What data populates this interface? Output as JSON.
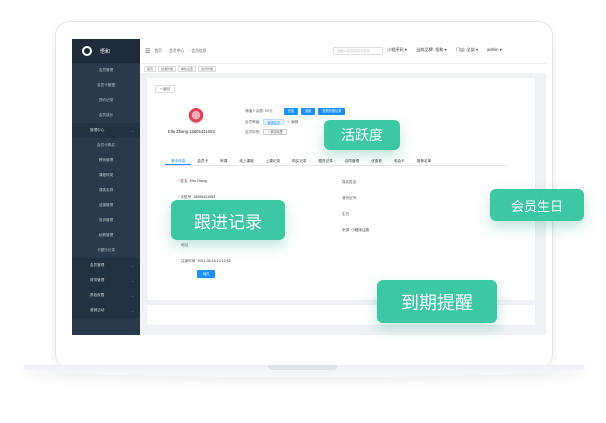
{
  "colors": {
    "accent": "#1890ff",
    "badge": "#3cc8a2",
    "sidebar": "#2b3a4a"
  },
  "sidebar": {
    "brand": "悟和",
    "items": [
      {
        "label": "会员管理",
        "type": "sub"
      },
      {
        "label": "会员卡管理",
        "type": "sub"
      },
      {
        "label": "预约记录",
        "type": "sub"
      },
      {
        "label": "会员成长",
        "type": "sub"
      },
      {
        "label": "管理中心",
        "type": "group"
      },
      {
        "label": "会员卡购买",
        "type": "sub"
      },
      {
        "label": "教师管理",
        "type": "sub"
      },
      {
        "label": "课程种类",
        "type": "sub"
      },
      {
        "label": "课类名称",
        "type": "sub"
      },
      {
        "label": "活课管理",
        "type": "sub"
      },
      {
        "label": "培训管理",
        "type": "sub"
      },
      {
        "label": "私教管理",
        "type": "sub"
      },
      {
        "label": "卡额抄记录",
        "type": "sub"
      },
      {
        "label": "会员管理",
        "type": "group"
      },
      {
        "label": "财务管理",
        "type": "group"
      },
      {
        "label": "角色权限",
        "type": "group"
      },
      {
        "label": "营销活动",
        "type": "group"
      }
    ]
  },
  "topbar": {
    "breadcrumb": [
      "首页",
      "会员中心",
      "会员信息"
    ],
    "search_placeholder": "请输入会员姓名/手机号",
    "right": [
      "小程序码 ▾",
      "当前品牌: 悟和 ▾",
      "门店: 全部 ▾",
      "admin ▾"
    ]
  },
  "tags": [
    "首页",
    "投课管理",
    "单处设置",
    "会员管理"
  ],
  "card": {
    "back_label": "< 返回",
    "member_name": "Ella Zhang 15605431553",
    "balance_label": "储值卡余额: ¥0元",
    "btn_recharge": "充值",
    "btn_refund": "退款",
    "btn_record": "查看充值记录",
    "level_label": "会员等级:",
    "level_value": "普通会员",
    "edit_label": "✎ 编辑",
    "tags_label": "会员标签:",
    "add_tag": "+ 添加标签",
    "tabs": [
      "基本信息",
      "会员卡",
      "练课",
      "线上课程",
      "上课记录",
      "购买记录",
      "跟进记录",
      "合同管理",
      "优惠券",
      "电会卡",
      "推荐名单"
    ],
    "fields_left": [
      {
        "label": "姓名",
        "value": "Ella Zhang",
        "required": true
      },
      {
        "label": "手机号",
        "value": "15605431553",
        "required": true
      },
      {
        "label": "",
        "value": "",
        "required": false
      },
      {
        "label": "",
        "value": "",
        "required": false
      },
      {
        "label": "地址",
        "value": "",
        "required": false
      },
      {
        "label": "注册时间",
        "value": "2021-06-16 12:12:52",
        "required": false
      }
    ],
    "fields_right": [
      {
        "label": "真实姓名",
        "value": ""
      },
      {
        "label": "身份证号",
        "value": ""
      },
      {
        "label": "生日",
        "value": ""
      },
      {
        "label": "来源",
        "value": "小程序注册"
      }
    ],
    "save_label": "保存"
  },
  "badges": {
    "activity": "活跃度",
    "followup": "跟进记录",
    "birthday": "会员生日",
    "expiry": "到期提醒"
  }
}
